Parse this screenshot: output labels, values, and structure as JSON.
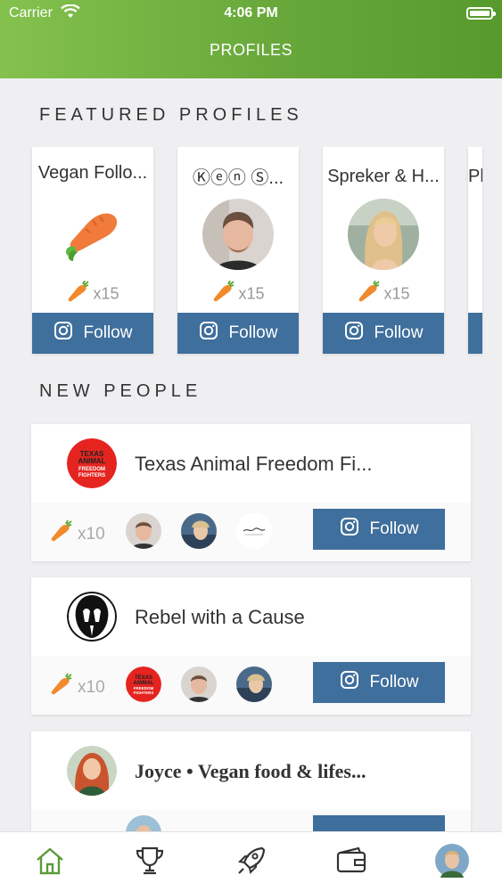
{
  "status_bar": {
    "carrier": "Carrier",
    "time": "4:06 PM"
  },
  "header": {
    "title": "PROFILES"
  },
  "featured": {
    "heading": "FEATURED PROFILES",
    "cards": [
      {
        "name": "Vegan Follo...",
        "count": "x15",
        "button": "Follow"
      },
      {
        "name": "Ⓚⓔⓝ Ⓢ...",
        "count": "x15",
        "button": "Follow"
      },
      {
        "name": "Spreker & H...",
        "count": "x15",
        "button": "Follow"
      },
      {
        "name": "Pl"
      }
    ]
  },
  "new_people": {
    "heading": "NEW PEOPLE",
    "cards": [
      {
        "name": "Texas Animal Freedom Fi...",
        "count": "x10",
        "button": "Follow",
        "avatar_text": [
          "TEXAS",
          "ANIMAL",
          "FREEDOM",
          "FIGHTERS"
        ]
      },
      {
        "name": "Rebel with a Cause",
        "count": "x10",
        "button": "Follow",
        "mini_text": [
          "TEXAS",
          "ANIMAL",
          "FREEDOM",
          "FIGHTERS"
        ]
      },
      {
        "name": "Joyce • Vegan food & lifes..."
      }
    ]
  },
  "tabbar": {
    "items": [
      "home-icon",
      "trophy-icon",
      "rocket-icon",
      "wallet-icon",
      "profile-avatar"
    ],
    "active": "home-icon"
  },
  "colors": {
    "header_start": "#84c14e",
    "header_end": "#579a2c",
    "button": "#3f6f9c",
    "active_tab": "#5d9a3a"
  }
}
